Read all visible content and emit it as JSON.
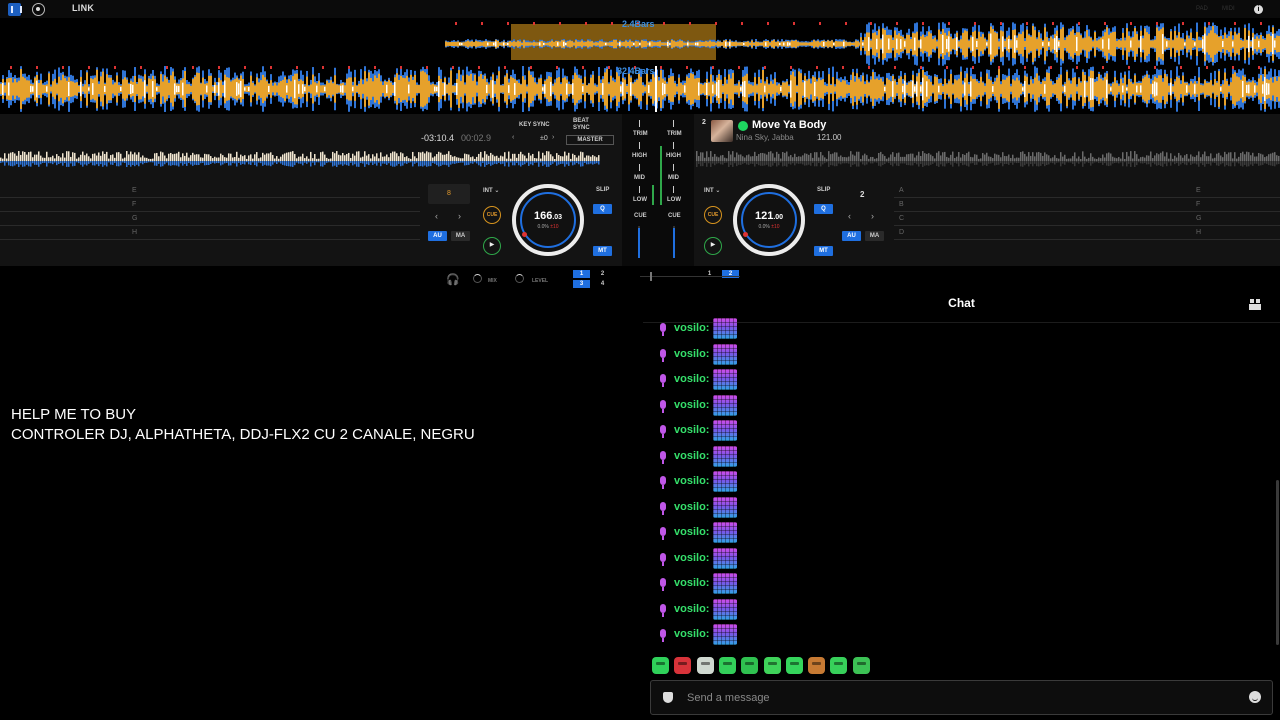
{
  "topbar": {
    "link_label": "LINK",
    "pad_label": "PAD",
    "midi_label": "MIDI",
    "info_glyph": "i"
  },
  "waveform": {
    "loop_label": "2.4Bars",
    "bars_label": "82.4Bars",
    "colors": {
      "orange": "#e6a12b",
      "blue": "#2f74d6",
      "white": "#ffffff"
    }
  },
  "deck1": {
    "time_remaining": "-03:10.4",
    "time_elapsed": "00:02.9",
    "key_sync_label": "KEY SYNC",
    "key_value": "±0",
    "beat_sync_label": "BEAT SYNC",
    "master_label": "MASTER",
    "pad_labels": [
      "E",
      "F",
      "G",
      "H"
    ],
    "beat_value": "8",
    "int_label": "INT",
    "slip_label": "SLIP",
    "q_label": "Q",
    "au_label": "AU",
    "ma_label": "MA",
    "mt_label": "MT",
    "cue_label": "CUE",
    "play_glyph": "▶",
    "bpm_int": "166",
    "bpm_dec": ".03",
    "pitch": "0.0%",
    "pitch_range": "±10"
  },
  "deck2": {
    "number": "2",
    "title": "Move Ya Body",
    "artist": "Nina Sky, Jabba",
    "bpm_display": "121.00",
    "pad_labels_left": [
      "A",
      "B",
      "C",
      "D"
    ],
    "pad_labels_right": [
      "E",
      "F",
      "G",
      "H"
    ],
    "beat_value": "2",
    "int_label": "INT",
    "slip_label": "SLIP",
    "q_label": "Q",
    "au_label": "AU",
    "ma_label": "MA",
    "mt_label": "MT",
    "cue_label": "CUE",
    "play_glyph": "▶",
    "bpm_int": "121",
    "bpm_dec": ".00",
    "pitch": "0.0%",
    "pitch_range": "±10"
  },
  "mixer": {
    "trim": "TRIM",
    "high": "HIGH",
    "mid": "MID",
    "low": "LOW",
    "cue": "CUE"
  },
  "bottom_strip": {
    "mix_label": "MIX",
    "level_label": "LEVEL",
    "deck_buttons_left": [
      "1",
      "2",
      "3",
      "4"
    ],
    "deck_buttons_right": [
      "1",
      "2"
    ]
  },
  "overlay": {
    "line1": "HELP ME TO BUY",
    "line2": "CONTROLER DJ, ALPHATHETA, DDJ-FLX2 CU 2 CANALE, NEGRU"
  },
  "chat": {
    "title": "Chat",
    "messages": [
      {
        "user": "vosilo:"
      },
      {
        "user": "vosilo:"
      },
      {
        "user": "vosilo:"
      },
      {
        "user": "vosilo:"
      },
      {
        "user": "vosilo:"
      },
      {
        "user": "vosilo:"
      },
      {
        "user": "vosilo:"
      },
      {
        "user": "vosilo:"
      },
      {
        "user": "vosilo:"
      },
      {
        "user": "vosilo:"
      },
      {
        "user": "vosilo:"
      },
      {
        "user": "vosilo:"
      },
      {
        "user": "vosilo:"
      }
    ],
    "emote_colors": [
      "#2fd15a",
      "#d8333a",
      "#cfd8d0",
      "#33cf5a",
      "#2fc150",
      "#3fd35a",
      "#35d55c",
      "#c77a33",
      "#37d05a",
      "#3cc255"
    ],
    "input_placeholder": "Send a message"
  }
}
